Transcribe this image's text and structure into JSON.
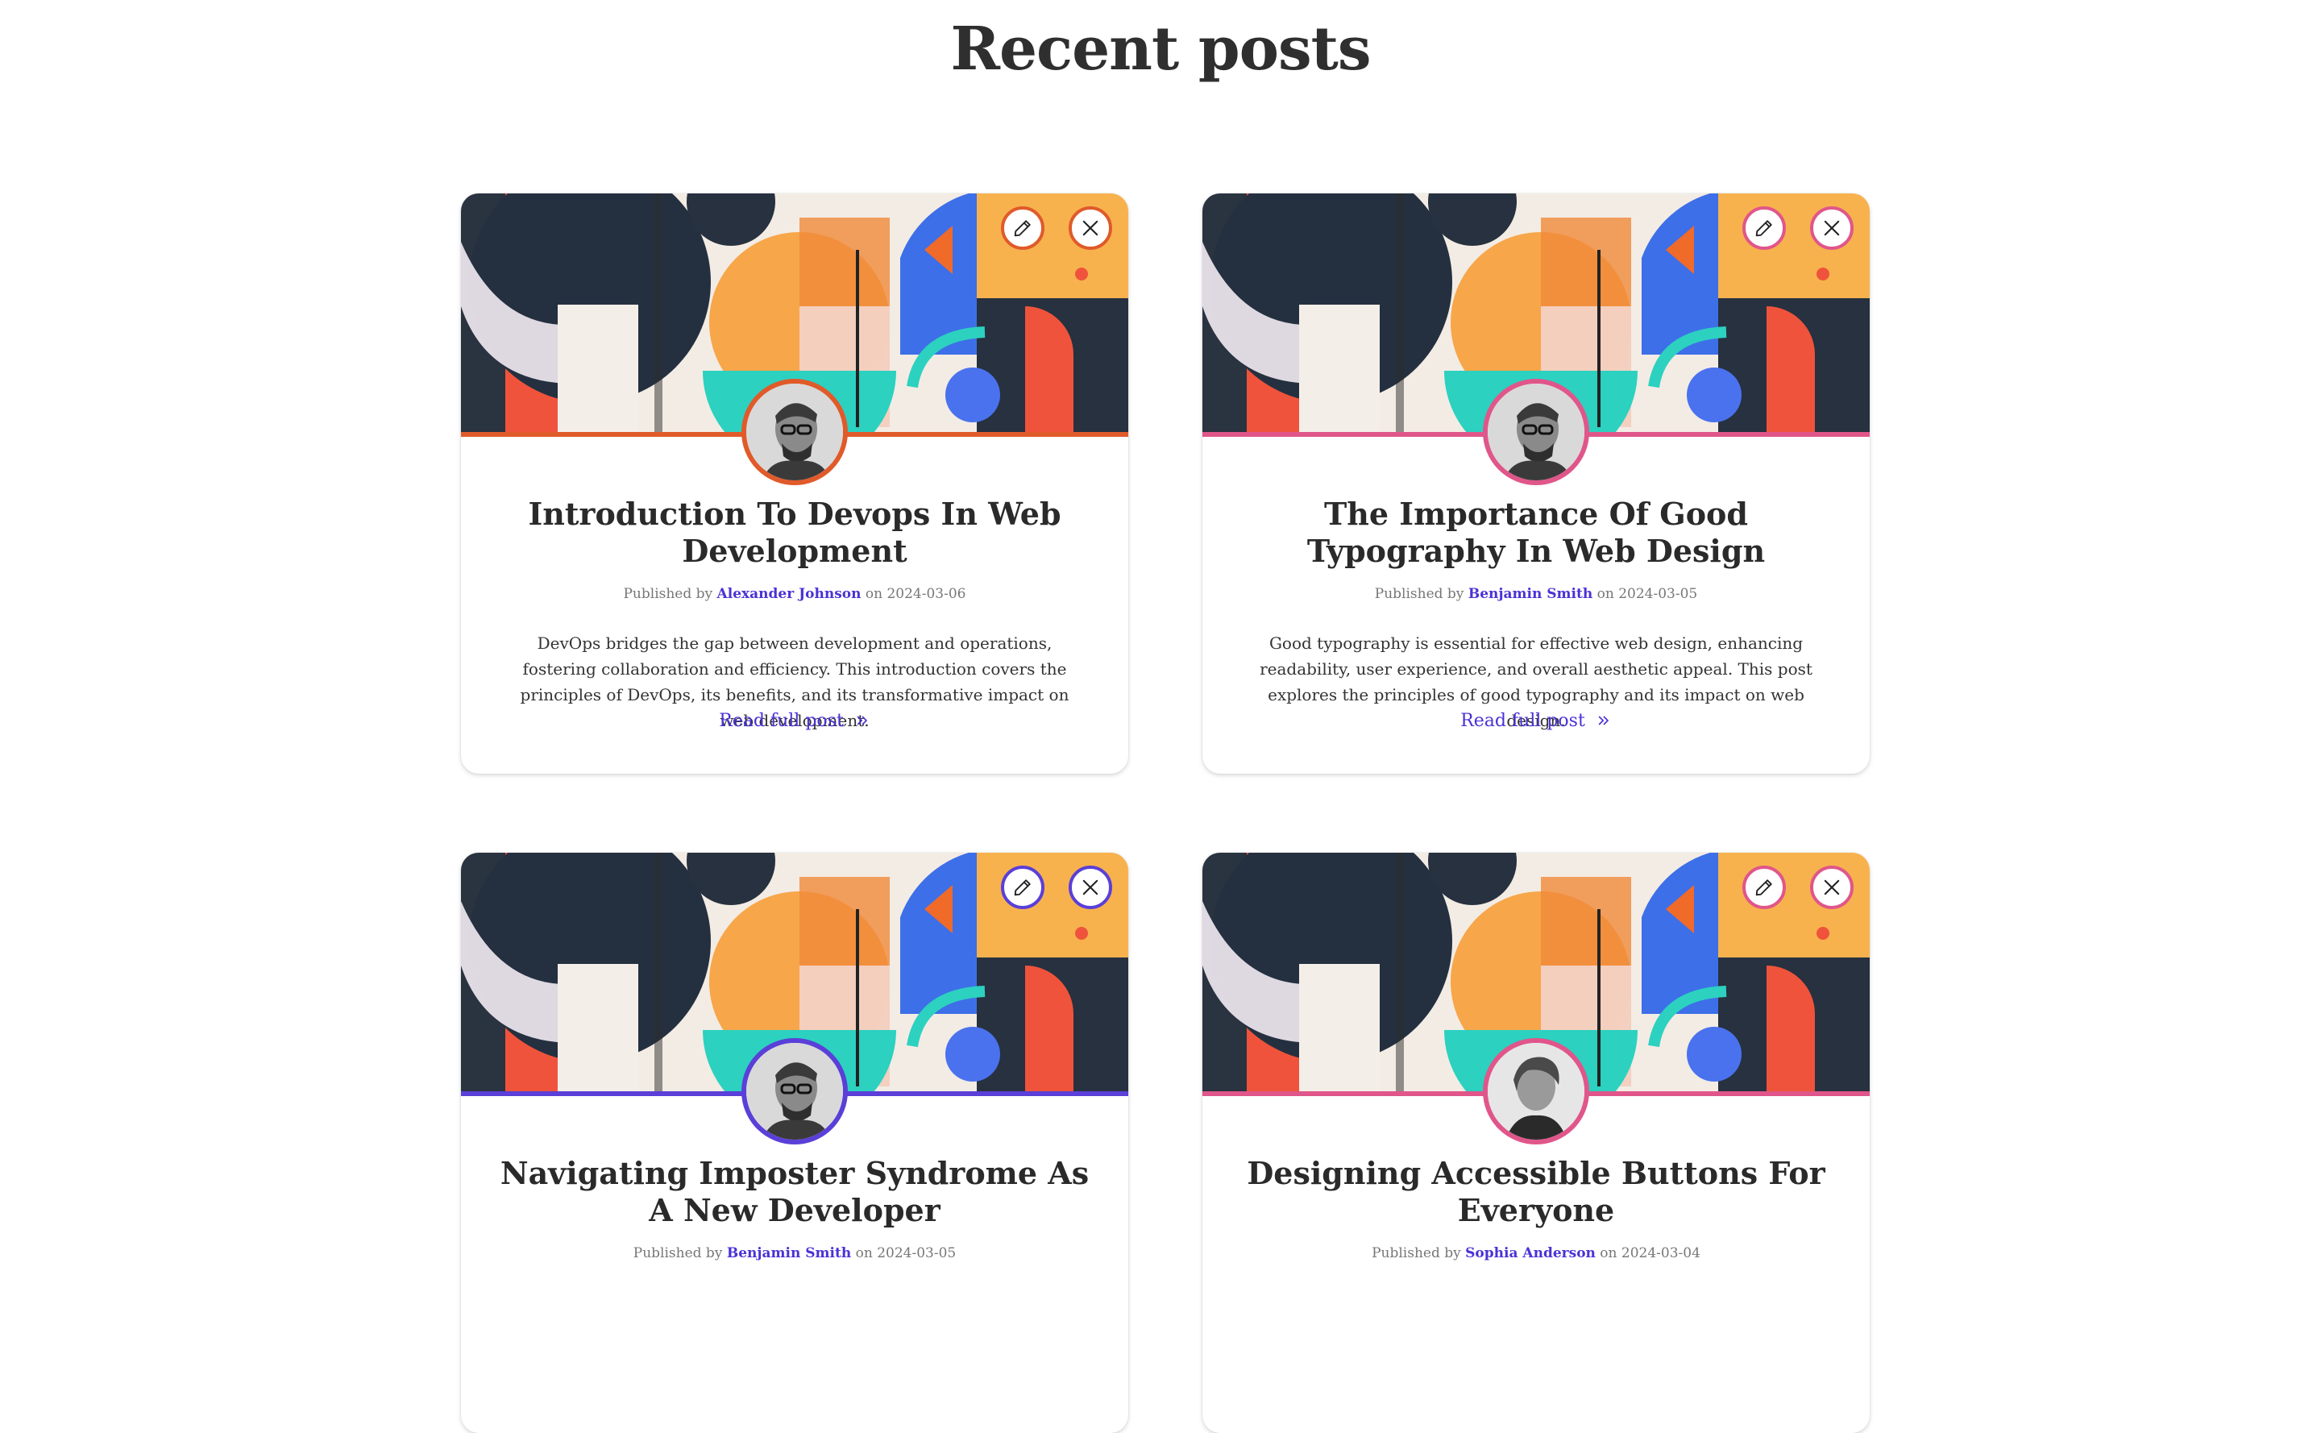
{
  "page": {
    "title": "Recent posts"
  },
  "colors": {
    "author_link": "#4a32d6",
    "read_more": "#4a32d6",
    "accent_orange": "#e05a2a",
    "accent_pink": "#e0568a",
    "accent_purple": "#5a3fd8"
  },
  "posts": [
    {
      "title": "Introduction To Devops In Web Development",
      "published_prefix": "Published by",
      "author": "Alexander Johnson",
      "date_prefix": "on",
      "date": "2024-03-06",
      "excerpt": "DevOps bridges the gap between development and operations, fostering collaboration and efficiency. This introduction covers the principles of DevOps, its benefits, and its transformative impact on web development.",
      "read_more": "Read full post",
      "accent": "#e05a2a",
      "avatar": "man-glasses",
      "edit_icon": "pencil-icon",
      "delete_icon": "close-icon"
    },
    {
      "title": "The Importance Of Good Typography In Web Design",
      "published_prefix": "Published by",
      "author": "Benjamin Smith",
      "date_prefix": "on",
      "date": "2024-03-05",
      "excerpt": "Good typography is essential for effective web design, enhancing readability, user experience, and overall aesthetic appeal. This post explores the principles of good typography and its impact on web design.",
      "read_more": "Read full post",
      "accent": "#e0568a",
      "avatar": "man-glasses",
      "edit_icon": "pencil-icon",
      "delete_icon": "close-icon"
    },
    {
      "title": "Navigating Imposter Syndrome As A New Developer",
      "published_prefix": "Published by",
      "author": "Benjamin Smith",
      "date_prefix": "on",
      "date": "2024-03-05",
      "excerpt": "",
      "read_more": "",
      "accent": "#5a3fd8",
      "avatar": "man-glasses",
      "edit_icon": "pencil-icon",
      "delete_icon": "close-icon"
    },
    {
      "title": "Designing Accessible Buttons For Everyone",
      "published_prefix": "Published by",
      "author": "Sophia Anderson",
      "date_prefix": "on",
      "date": "2024-03-04",
      "excerpt": "",
      "read_more": "",
      "accent": "#e0568a",
      "avatar": "woman",
      "edit_icon": "pencil-icon",
      "delete_icon": "close-icon"
    }
  ]
}
